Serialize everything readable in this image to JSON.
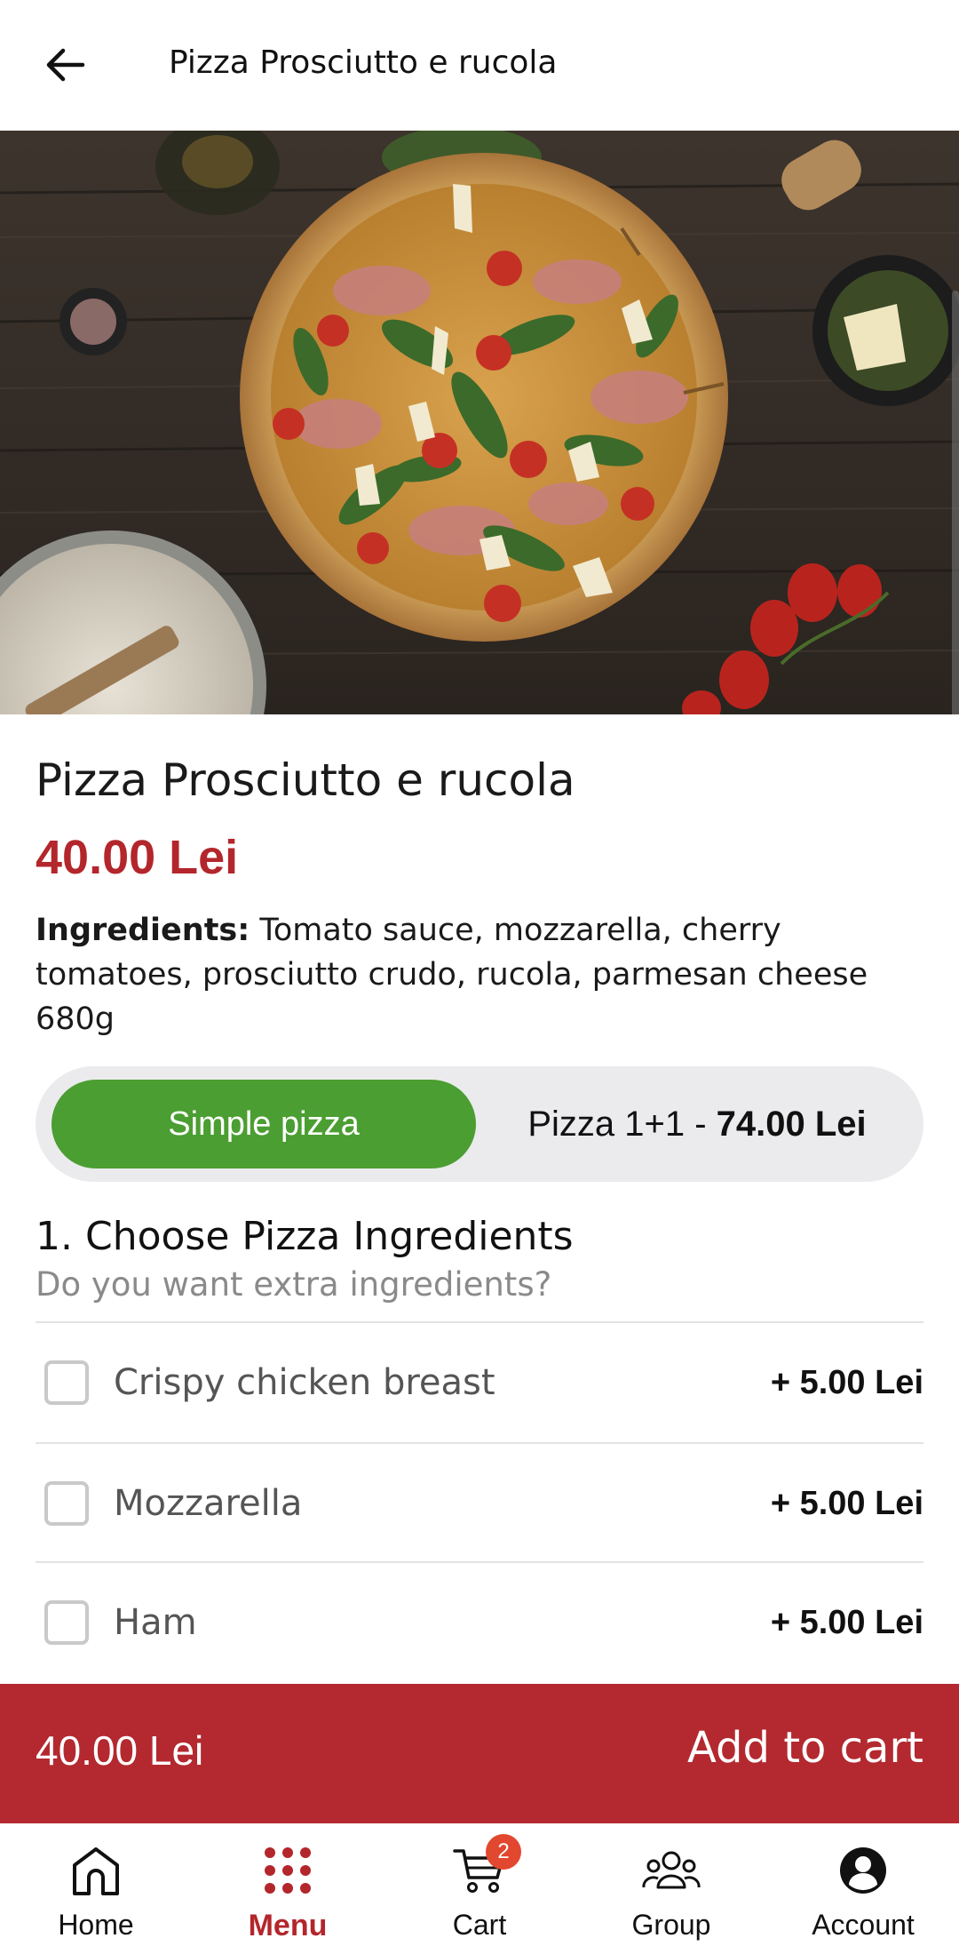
{
  "header": {
    "title": "Pizza Prosciutto e rucola"
  },
  "product": {
    "name": "Pizza Prosciutto e rucola",
    "price": "40.00 Lei",
    "ingredients_label": "Ingredients:",
    "ingredients_text": " Tomato sauce, mozzarella, cherry tomatoes, prosciutto crudo, rucola, parmesan cheese",
    "weight": "680g"
  },
  "variant_toggle": {
    "options": [
      {
        "label": "Simple pizza",
        "active": true
      },
      {
        "label": "Pizza 1+1 - ",
        "price": "74.00 Lei",
        "active": false
      }
    ]
  },
  "section": {
    "title": "1. Choose Pizza Ingredients",
    "subtitle": "Do you want extra ingredients?",
    "options": [
      {
        "label": "Crispy chicken breast",
        "price": "+ 5.00 Lei",
        "checked": false
      },
      {
        "label": "Mozzarella",
        "price": "+ 5.00 Lei",
        "checked": false
      },
      {
        "label": "Ham",
        "price": "+ 5.00 Lei",
        "checked": false
      }
    ]
  },
  "cart_bar": {
    "total": "40.00 Lei",
    "button_label": "Add to cart"
  },
  "bottom_nav": {
    "items": [
      {
        "label": "Home",
        "icon": "home-icon",
        "active": false
      },
      {
        "label": "Menu",
        "icon": "menu-grid-icon",
        "active": true
      },
      {
        "label": "Cart",
        "icon": "cart-icon",
        "active": false,
        "badge": "2"
      },
      {
        "label": "Group",
        "icon": "group-icon",
        "active": false
      },
      {
        "label": "Account",
        "icon": "account-icon",
        "active": false
      }
    ]
  },
  "colors": {
    "brand_red": "#b3262b",
    "toggle_green": "#4b9e31",
    "badge_orange": "#e2472f"
  }
}
